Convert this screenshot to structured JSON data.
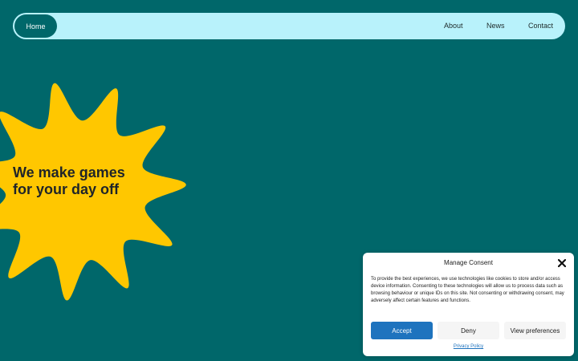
{
  "nav": {
    "home": "Home",
    "links": [
      "About",
      "News",
      "Contact"
    ]
  },
  "hero": {
    "title": "We make games for your day off"
  },
  "consent": {
    "title": "Manage Consent",
    "body": "To provide the best experiences, we use technologies like cookies to store and/or access device information. Consenting to these technologies will allow us to process data such as browsing behaviour or unique IDs on this site. Not consenting or withdrawing consent, may adversely affect certain features and functions.",
    "accept": "Accept",
    "deny": "Deny",
    "preferences": "View preferences",
    "privacy": "Privacy Policy",
    "close_icon": "close-icon"
  },
  "colors": {
    "background": "#00676a",
    "nav_bg": "#b8f2fb",
    "flower": "#ffc700",
    "accent": "#1e73be"
  }
}
